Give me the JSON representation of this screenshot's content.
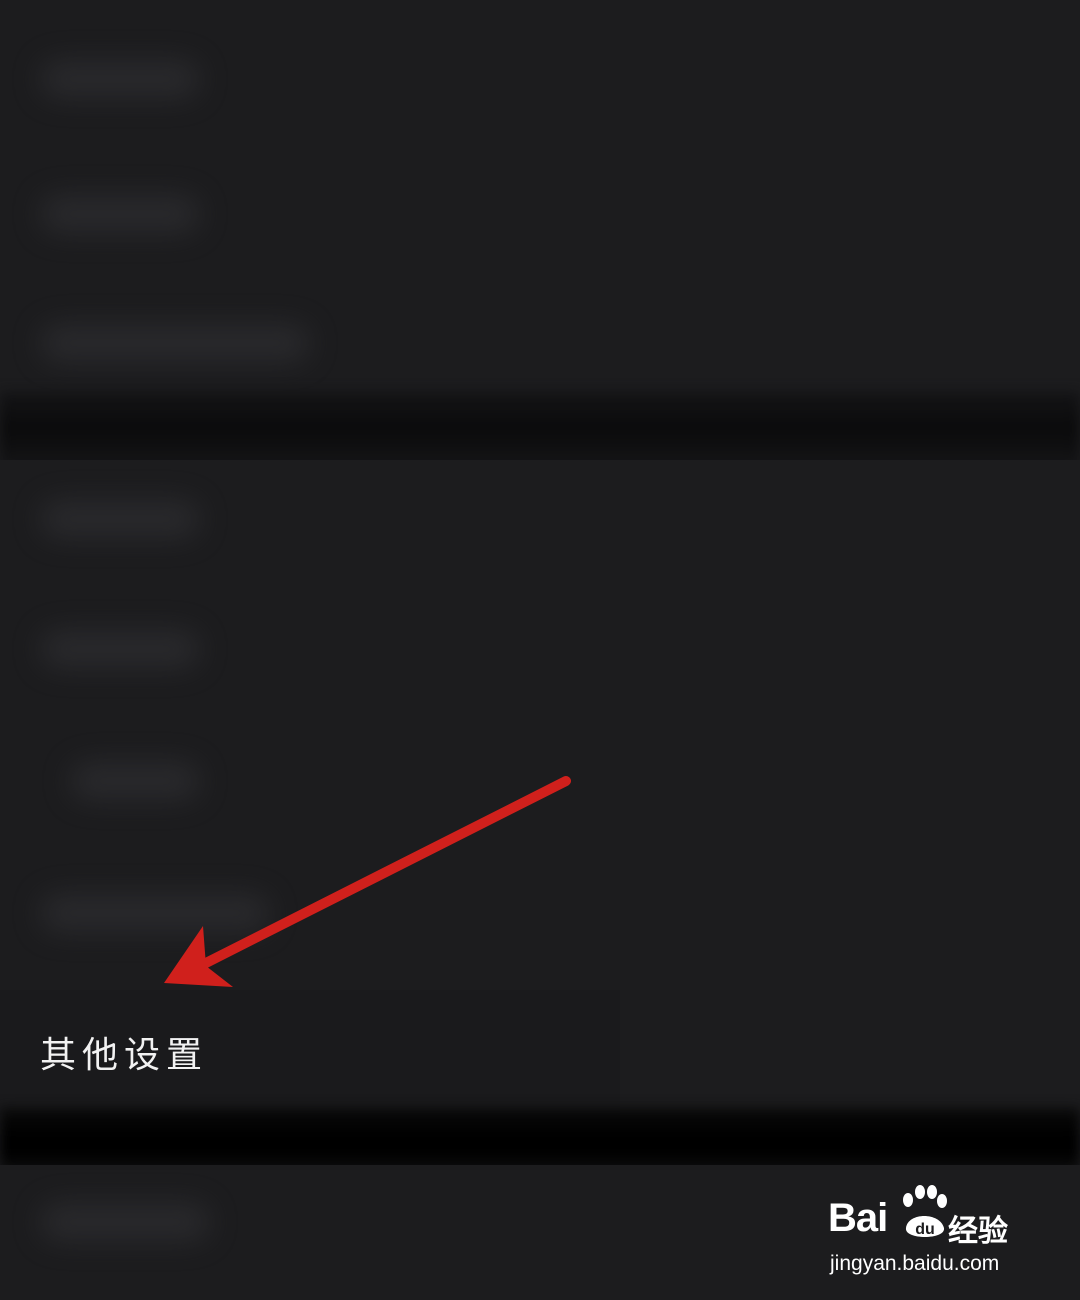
{
  "settings": {
    "other_settings_label": "其他设置"
  },
  "watermark": {
    "brand_text": "Bai",
    "brand_text_du": "du",
    "brand_cn": "经验",
    "url": "jingyan.baidu.com"
  },
  "colors": {
    "background": "#1c1c1e",
    "arrow": "#d0201c",
    "text": "#f2f2f2"
  },
  "icons": [
    "paw-icon",
    "red-arrow-annotation"
  ]
}
